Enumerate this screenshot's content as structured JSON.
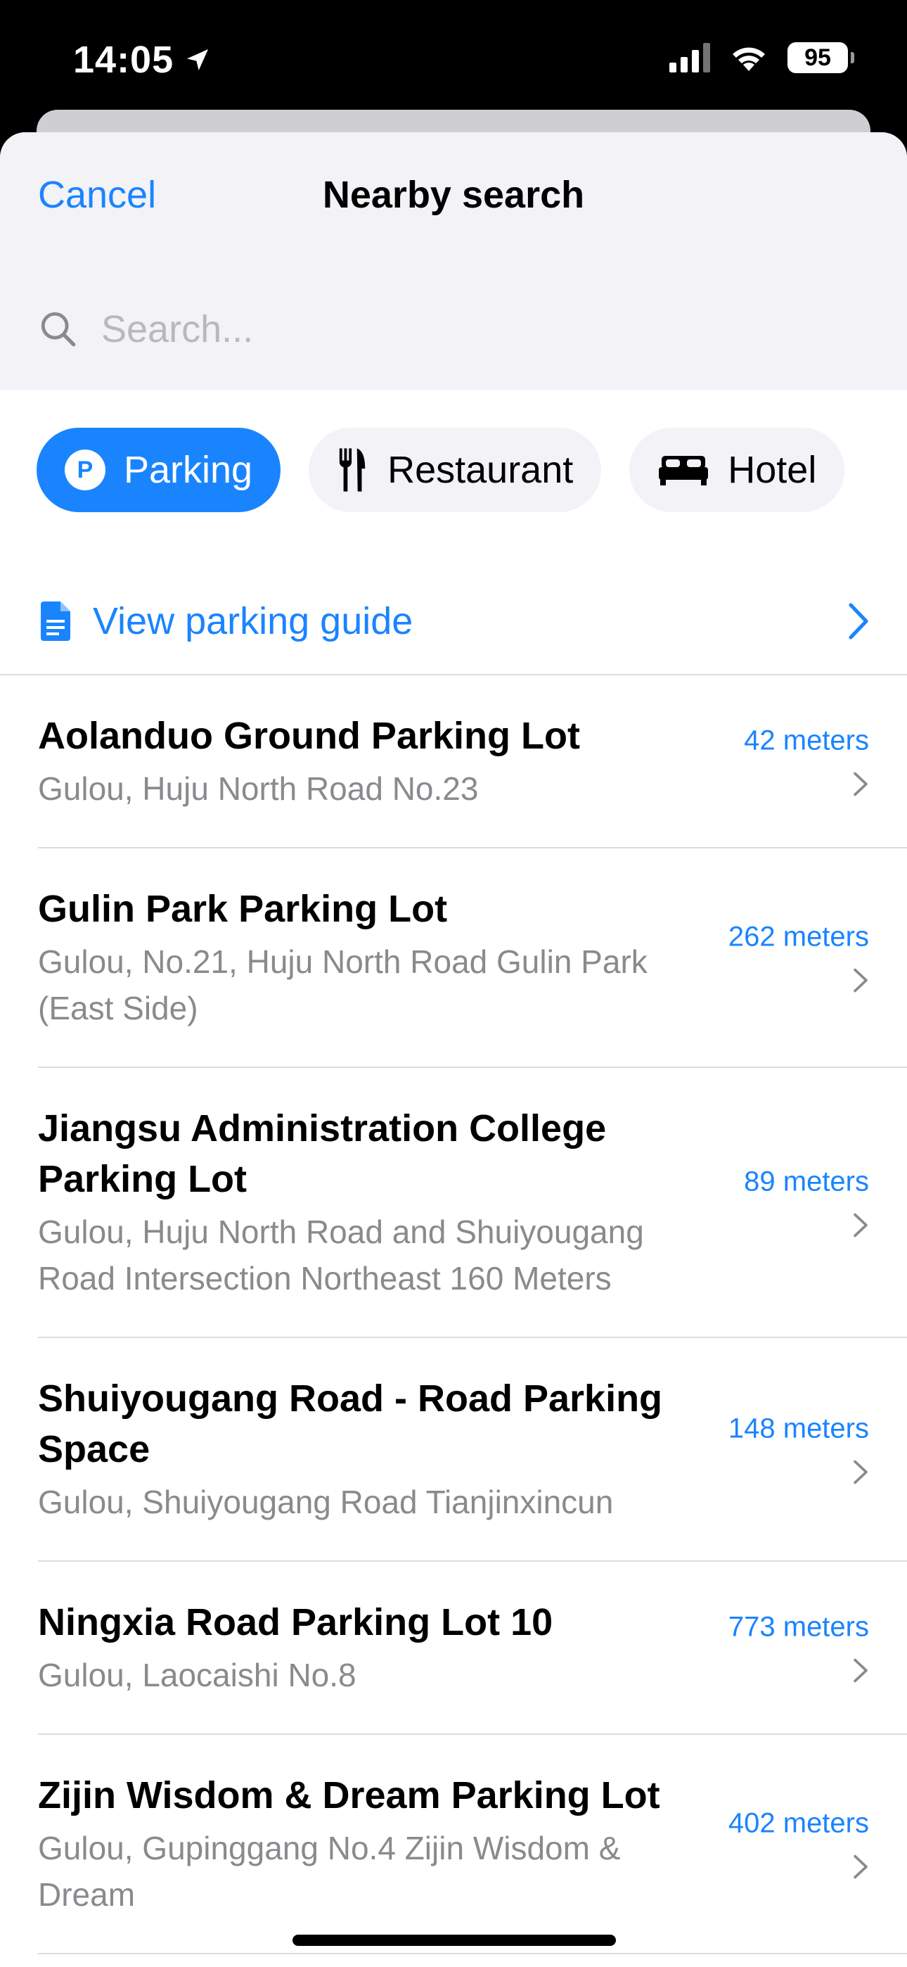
{
  "status_bar": {
    "time": "14:05",
    "battery": "95"
  },
  "header": {
    "cancel_label": "Cancel",
    "title": "Nearby search"
  },
  "search": {
    "placeholder": "Search..."
  },
  "categories": [
    {
      "label": "Parking",
      "icon": "parking-icon",
      "selected": true
    },
    {
      "label": "Restaurant",
      "icon": "fork-knife-icon",
      "selected": false
    },
    {
      "label": "Hotel",
      "icon": "bed-icon",
      "selected": false
    }
  ],
  "guide": {
    "label": "View parking guide"
  },
  "results": [
    {
      "name": "Aolanduo Ground Parking Lot",
      "address": "Gulou, Huju North Road No.23",
      "distance": "42 meters"
    },
    {
      "name": "Gulin Park Parking Lot",
      "address": "Gulou, No.21, Huju North Road Gulin Park (East Side)",
      "distance": "262 meters"
    },
    {
      "name": "Jiangsu Administration College Parking Lot",
      "address": "Gulou, Huju North Road and Shuiyougang Road Intersection Northeast 160 Meters",
      "distance": "89 meters"
    },
    {
      "name": "Shuiyougang Road - Road Parking Space",
      "address": "Gulou, Shuiyougang Road Tianjinxincun",
      "distance": "148 meters"
    },
    {
      "name": "Ningxia Road Parking Lot 10",
      "address": "Gulou, Laocaishi No.8",
      "distance": "773 meters"
    },
    {
      "name": "Zijin Wisdom & Dream Parking Lot",
      "address": "Gulou, Gupinggang No.4 Zijin Wisdom & Dream",
      "distance": "402 meters"
    }
  ],
  "colors": {
    "accent": "#1a84ff",
    "secondary_text": "#8a8a8e",
    "header_bg": "#f2f2f7"
  }
}
